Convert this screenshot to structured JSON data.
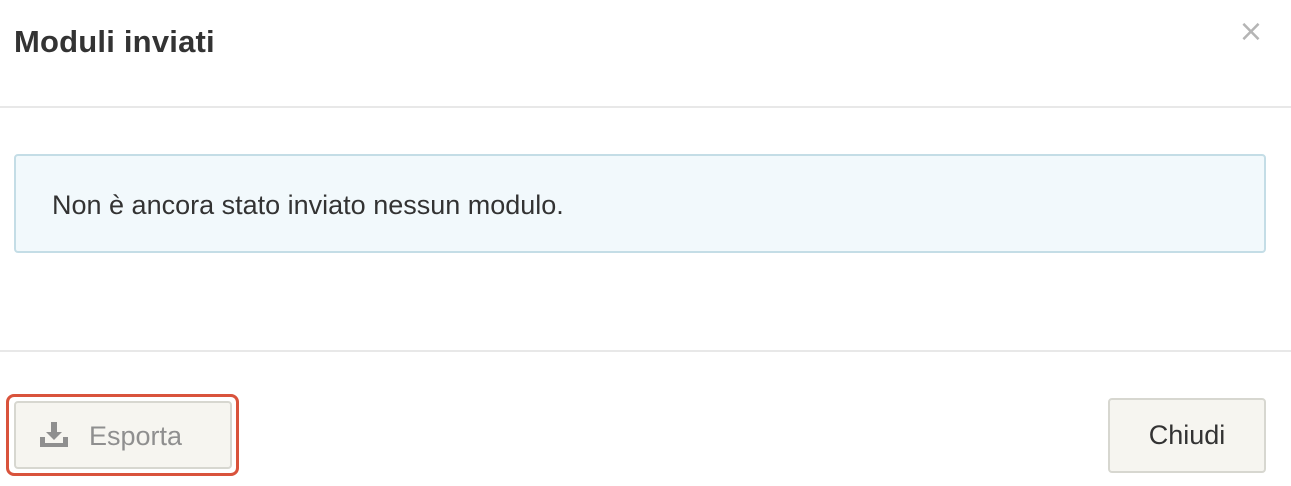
{
  "modal": {
    "title": "Moduli inviati",
    "close_glyph": "×",
    "close_icon": "close-icon"
  },
  "body": {
    "alert_text": "Non è ancora stato inviato nessun modulo."
  },
  "footer": {
    "export_label": "Esporta",
    "export_icon": "download-icon",
    "close_label": "Chiudi"
  },
  "colors": {
    "alert_background": "#f2f9fc",
    "alert_border": "#c4dde6",
    "button_background": "#f6f5f0",
    "highlight_border": "#d9533c",
    "disabled_text": "#8f8f8f"
  }
}
